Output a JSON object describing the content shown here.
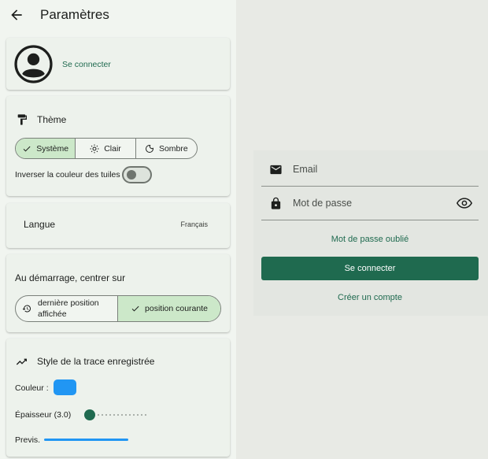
{
  "appbar": {
    "title": "Paramètres",
    "back_icon": "arrow-back-icon"
  },
  "account": {
    "login_link": "Se connecter",
    "avatar_icon": "account-circle-icon"
  },
  "theme": {
    "title": "Thème",
    "icon": "paint-roller-icon",
    "options": [
      "Système",
      "Clair",
      "Sombre"
    ],
    "selected": "Système",
    "invert_tiles_label": "Inverser la couleur des tuiles",
    "invert_tiles_on": false
  },
  "language": {
    "label": "Langue",
    "value": "Français"
  },
  "startup": {
    "title": "Au démarrage, centrer sur",
    "options": [
      "dernière position affichée",
      "position courante"
    ],
    "option1_line1": "dernière position",
    "option1_line2": "affichée",
    "selected": "position courante"
  },
  "trace_style": {
    "title": "Style de la trace enregistrée",
    "icon": "trending-line-icon",
    "color_label": "Couleur :",
    "color": "#2196f3",
    "thickness_label": "Épaisseur (3.0)",
    "thickness_fraction": 0.0,
    "preview_label": "Previs."
  },
  "login_form": {
    "email_label": "Email",
    "password_label": "Mot de passe",
    "forgot_link": "Mot de passe oublié",
    "submit_button": "Se connecter",
    "create_account_link": "Créer un compte"
  },
  "colors": {
    "primary": "#1f6a4f",
    "selected_segment": "#cce8c9",
    "trace_color": "#2196f3"
  }
}
